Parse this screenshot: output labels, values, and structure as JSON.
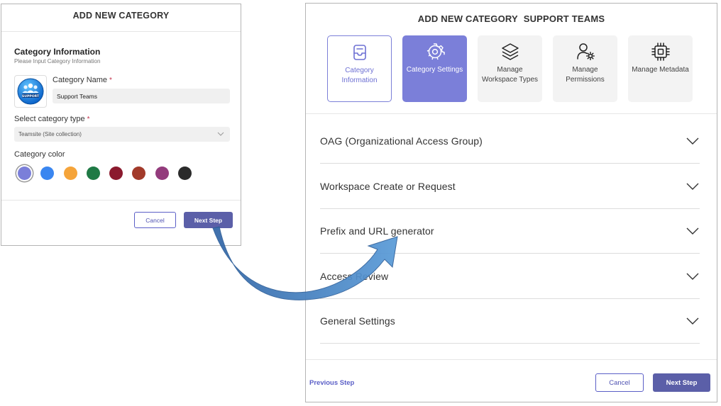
{
  "left_dialog": {
    "title": "ADD NEW CATEGORY",
    "section_title": "Category Information",
    "section_subtitle": "Please Input Category Information",
    "logo_text": "SUPPORT",
    "name_label": "Category Name",
    "name_value": "Support Teams",
    "type_label": "Select category type",
    "type_value": "Teamsite (Site collection)",
    "color_label": "Category color",
    "colors": [
      "#7b7fd9",
      "#3a86f0",
      "#f5a43a",
      "#1f7a45",
      "#8b1a2e",
      "#a23a2a",
      "#933b7c",
      "#2b2b2b"
    ],
    "selected_color_index": 0,
    "cancel_label": "Cancel",
    "next_label": "Next Step"
  },
  "right_dialog": {
    "title_prefix": "ADD NEW CATEGORY",
    "title_name": "SUPPORT TEAMS",
    "steps": [
      {
        "label": "Category Information",
        "icon": "tray-icon",
        "state": "completed"
      },
      {
        "label": "Category Settings",
        "icon": "settings-gear-icon",
        "state": "active"
      },
      {
        "label": "Manage Workspace Types",
        "icon": "layers-icon",
        "state": "pending"
      },
      {
        "label": "Manage Permissions",
        "icon": "person-settings-icon",
        "state": "pending"
      },
      {
        "label": "Manage Metadata",
        "icon": "chip-icon",
        "state": "pending"
      }
    ],
    "sections": [
      "OAG (Organizational Access Group)",
      "Workspace Create or Request",
      "Prefix and URL generator",
      "Access Review",
      "General Settings"
    ],
    "previous_label": "Previous Step",
    "cancel_label": "Cancel",
    "next_label": "Next Step"
  },
  "colors": {
    "accent": "#5b5fc7",
    "active_step": "#7b7fd9",
    "arrow": "#3f7fbe",
    "required": "#c4314b"
  }
}
